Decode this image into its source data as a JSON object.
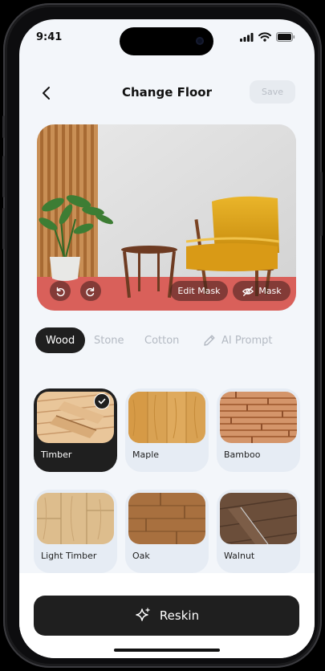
{
  "status_bar": {
    "time": "9:41"
  },
  "header": {
    "title": "Change Floor",
    "save_label": "Save"
  },
  "preview": {
    "edit_mask_label": "Edit Mask",
    "mask_label": "Mask"
  },
  "tabs": [
    {
      "label": "Wood",
      "active": true
    },
    {
      "label": "Stone",
      "active": false
    },
    {
      "label": "Cotton",
      "active": false
    },
    {
      "label": "AI Prompt",
      "active": false,
      "icon": "pencil-icon"
    }
  ],
  "materials": [
    {
      "label": "Timber",
      "selected": true
    },
    {
      "label": "Maple",
      "selected": false
    },
    {
      "label": "Bamboo",
      "selected": false
    },
    {
      "label": "Light Timber",
      "selected": false
    },
    {
      "label": "Oak",
      "selected": false
    },
    {
      "label": "Walnut",
      "selected": false
    }
  ],
  "actions": {
    "reskin_label": "Reskin"
  },
  "colors": {
    "accent": "#1f1f1f",
    "mask": "#d9605a",
    "chair": "#e0a418",
    "background": "#f3f6fa"
  }
}
